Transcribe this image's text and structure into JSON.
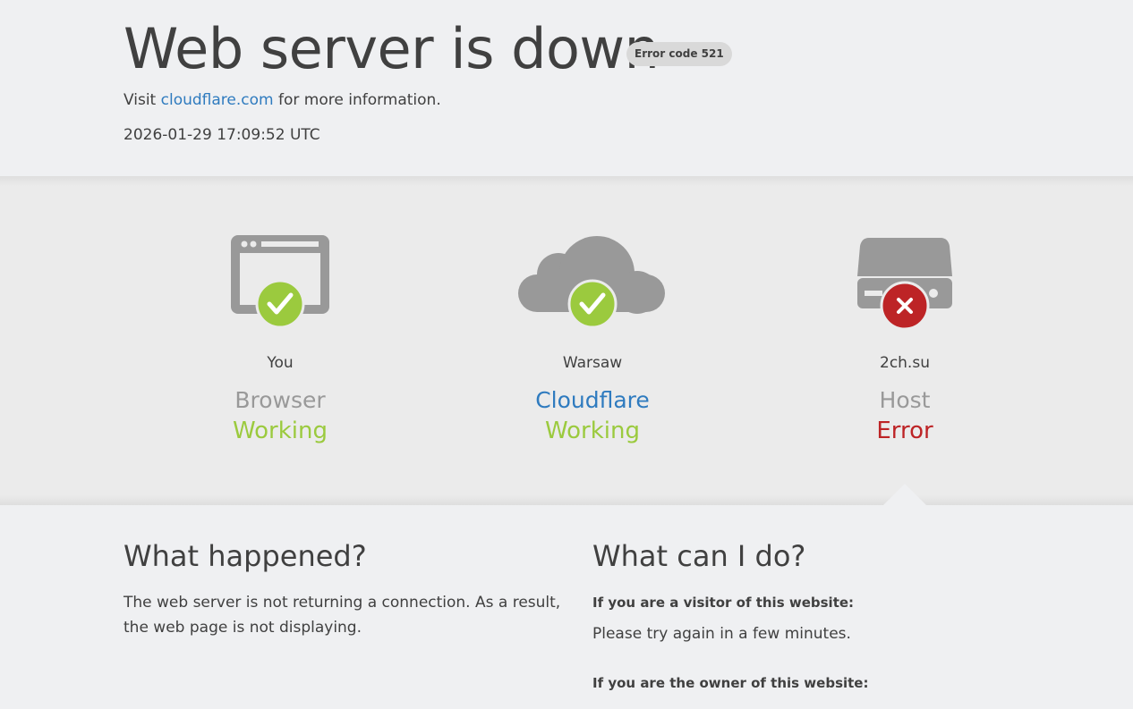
{
  "header": {
    "title": "Web server is down",
    "error_code": "Error code 521",
    "visit_prefix": "Visit",
    "visit_link": "cloudflare.com",
    "visit_suffix": "for more information.",
    "timestamp": "2026-01-29 17:09:52 UTC"
  },
  "nodes": [
    {
      "location": "You",
      "name": "Browser",
      "status": "Working",
      "icon": "browser-icon",
      "state": "ok"
    },
    {
      "location": "Warsaw",
      "name": "Cloudflare",
      "status": "Working",
      "icon": "cloud-icon",
      "state": "ok"
    },
    {
      "location": "2ch.su",
      "name": "Host",
      "status": "Error",
      "icon": "server-icon",
      "state": "error"
    }
  ],
  "colors": {
    "working": "#9bca3e",
    "error": "#bd2426",
    "link": "#2f7bbf",
    "icon_gray": "#999999"
  },
  "what_happened": {
    "heading": "What happened?",
    "text": "The web server is not returning a connection. As a result, the web page is not displaying."
  },
  "what_can_i_do": {
    "heading": "What can I do?",
    "visitor_heading": "If you are a visitor of this website:",
    "visitor_text": "Please try again in a few minutes.",
    "owner_heading": "If you are the owner of this website:"
  }
}
